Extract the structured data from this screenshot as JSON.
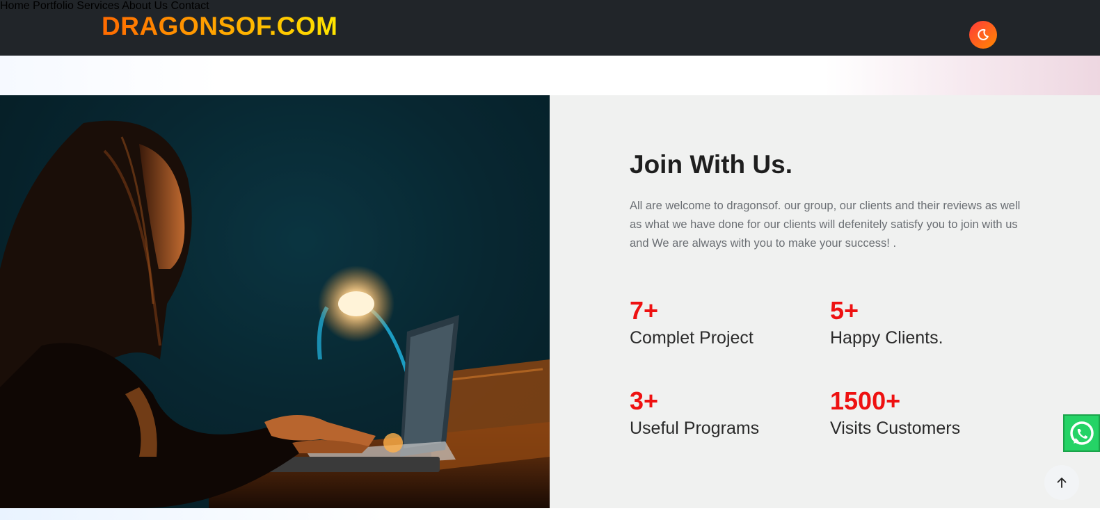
{
  "navbar": {
    "brand": "DRAGONSOF.COM",
    "links": [
      {
        "label": "Home"
      },
      {
        "label": "Portfolio"
      },
      {
        "label": "Services"
      },
      {
        "label": "About Us"
      },
      {
        "label": "Contact"
      }
    ],
    "theme_toggle_icon": "moon-icon"
  },
  "join": {
    "title": "Join With Us.",
    "description": "All are welcome to dragonsof. our group, our clients and their reviews as well as what we have done for our clients will defenitely satisfy you to join with us and We are always with you to make your success! .",
    "image_icon": "woman-at-laptop-photo",
    "stats": [
      {
        "value": "7+",
        "label": "Complet Project"
      },
      {
        "value": "5+",
        "label": "Happy Clients."
      },
      {
        "value": "3+",
        "label": "Useful Programs"
      },
      {
        "value": "1500+",
        "label": "Visits Customers"
      }
    ]
  },
  "floating": {
    "whatsapp_icon": "whatsapp-icon",
    "back_to_top_icon": "arrow-up-icon"
  },
  "colors": {
    "navbar_bg": "#212529",
    "accent_red": "#ee1111",
    "brand_gradient_start": "#ff6a00",
    "brand_gradient_end": "#ffe600",
    "whatsapp_green": "#25d366"
  }
}
